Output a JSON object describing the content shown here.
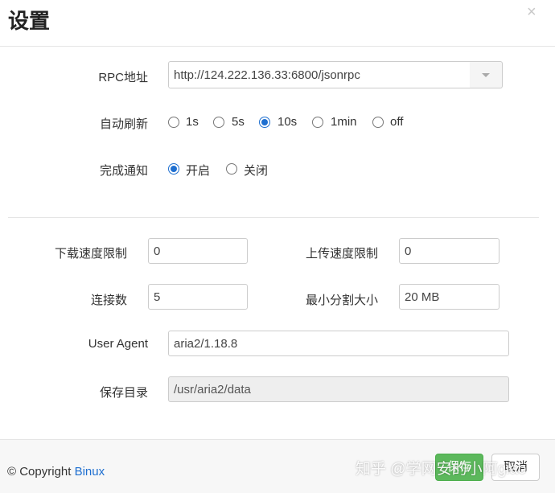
{
  "dialog": {
    "title": "设置",
    "close": "×"
  },
  "rpc": {
    "label": "RPC地址",
    "value": "http://124.222.136.33:6800/jsonrpc"
  },
  "auto_refresh": {
    "label": "自动刷新",
    "options": [
      "1s",
      "5s",
      "10s",
      "1min",
      "off"
    ],
    "selected": "10s"
  },
  "notify": {
    "label": "完成通知",
    "options": [
      "开启",
      "关闭"
    ],
    "selected": "开启"
  },
  "download_limit": {
    "label": "下载速度限制",
    "value": "0"
  },
  "upload_limit": {
    "label": "上传速度限制",
    "value": "0"
  },
  "connections": {
    "label": "连接数",
    "value": "5"
  },
  "min_split": {
    "label": "最小分割大小",
    "value": "20 MB"
  },
  "user_agent": {
    "label": "User Agent",
    "value": "aria2/1.18.8"
  },
  "save_dir": {
    "label": "保存目录",
    "value": "/usr/aria2/data"
  },
  "footer": {
    "copyright_prefix": "© Copyright ",
    "copyright_link": "Binux",
    "save_label": "保存",
    "cancel_label": "取消"
  },
  "watermark": "知乎 @学网安的小阿giao",
  "colors": {
    "accent": "#1e6fd0",
    "save": "#5cb85c"
  },
  "icons": {
    "close": "close-icon",
    "dropdown": "caret-down-icon"
  }
}
